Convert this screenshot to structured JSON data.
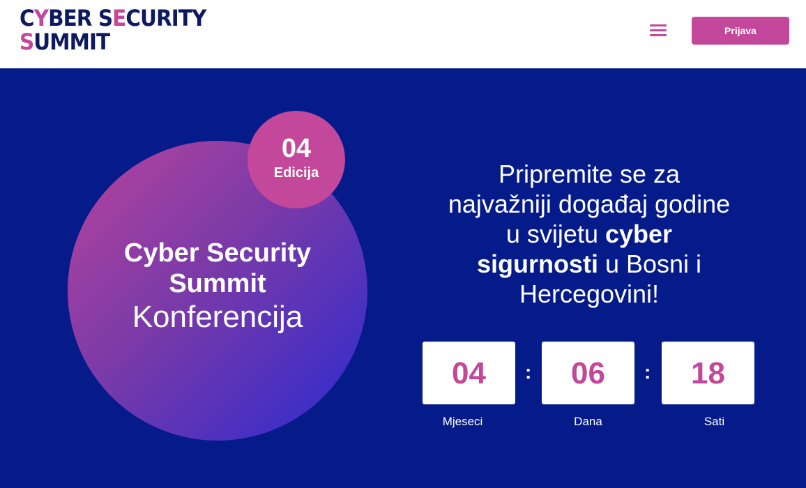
{
  "header": {
    "logo_line1_a": "C",
    "logo_line1_b": "Y",
    "logo_line1_c": "BER S",
    "logo_line1_d": "E",
    "logo_line1_e": "CURITY",
    "logo_line2_a": "S",
    "logo_line2_b": "UMMIT",
    "login_label": "Prijava",
    "menu_icon": "hamburger-icon"
  },
  "hero": {
    "circle_line1": "Cyber Security",
    "circle_line2": "Summit",
    "circle_line3": "Konferencija",
    "edition_number": "04",
    "edition_label": "Edicija",
    "tagline_part1": "Pripremite se za najvažniji događaj godine u svijetu",
    "tagline_bold": "cyber sigurnosti",
    "tagline_part2": "u Bosni i Hercegovini!"
  },
  "countdown": {
    "items": [
      {
        "value": "04",
        "label": "Mjeseci"
      },
      {
        "value": "06",
        "label": "Dana"
      },
      {
        "value": "18",
        "label": "Sati"
      }
    ],
    "separator": ":"
  },
  "colors": {
    "brand_navy": "#061b8a",
    "brand_pink": "#c3479a",
    "logo_navy": "#0e1a5e"
  }
}
